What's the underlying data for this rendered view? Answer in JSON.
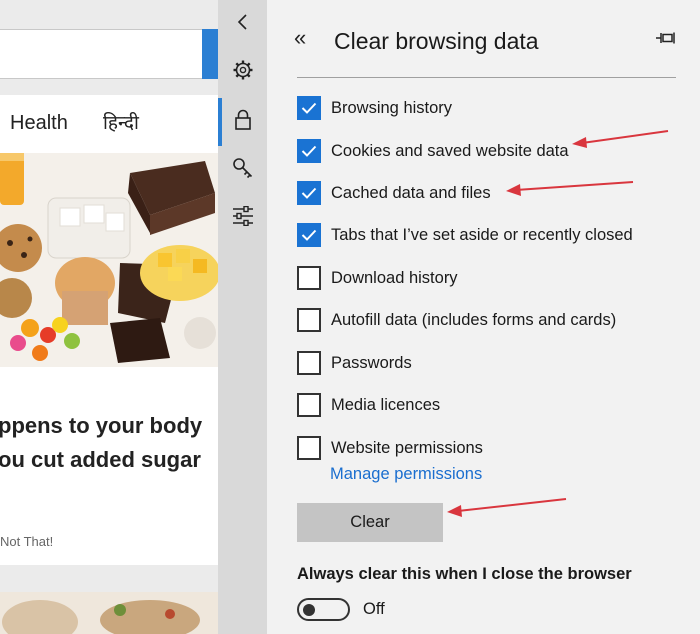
{
  "nav": {
    "items": [
      "Health",
      "हिन्दी"
    ]
  },
  "article": {
    "headline_line1": "ppens to your body",
    "headline_line2": "ou cut added sugar",
    "source": "Not That!"
  },
  "rail": {
    "icons": [
      "chevron-left-icon",
      "gear-icon",
      "lock-icon",
      "key-icon",
      "sliders-icon"
    ],
    "active": "lock-icon"
  },
  "panel": {
    "title": "Clear browsing data",
    "collapse_glyph": "«",
    "options": [
      {
        "label": "Browsing history",
        "checked": true
      },
      {
        "label": "Cookies and saved website data",
        "checked": true
      },
      {
        "label": "Cached data and files",
        "checked": true
      },
      {
        "label": "Tabs that I’ve set aside or recently closed",
        "checked": true
      },
      {
        "label": "Download history",
        "checked": false
      },
      {
        "label": "Autofill data (includes forms and cards)",
        "checked": false
      },
      {
        "label": "Passwords",
        "checked": false
      },
      {
        "label": "Media licences",
        "checked": false
      },
      {
        "label": "Website permissions",
        "checked": false
      }
    ],
    "manage_link": "Manage permissions",
    "clear_button": "Clear",
    "always_clear_label": "Always clear this when I close the browser",
    "toggle_state": "Off"
  },
  "colors": {
    "accent": "#1a73d3",
    "link": "#1a6ecf",
    "annotation_arrow": "#d9363e"
  }
}
